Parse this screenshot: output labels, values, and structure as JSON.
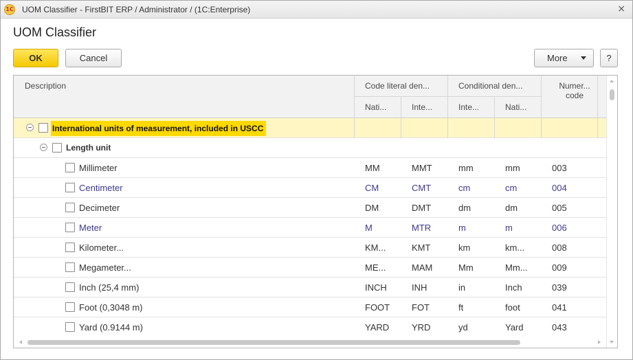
{
  "window": {
    "title": "UOM Classifier - FirstBIT ERP / Administrator /  (1C:Enterprise)",
    "logo_text": "1C",
    "close_glyph": "×"
  },
  "form": {
    "title": "UOM Classifier"
  },
  "toolbar": {
    "ok_label": "OK",
    "cancel_label": "Cancel",
    "more_label": "More",
    "help_label": "?"
  },
  "table": {
    "headers": {
      "description": "Description",
      "code_literal": "Code literal den...",
      "conditional": "Conditional den...",
      "numeric_code": "Numer...\ncode",
      "sub": [
        "Nati...",
        "Inte...",
        "Inte...",
        "Nati..."
      ]
    },
    "group": {
      "label": "International units of measurement, included in USCC"
    },
    "subgroup": {
      "label": "Length unit"
    },
    "rows": [
      {
        "description": "Millimeter",
        "national": "MM",
        "international": "MMT",
        "cond_international": "mm",
        "cond_national": "mm",
        "numeric": "003",
        "highlight": false
      },
      {
        "description": "Centimeter",
        "national": "CM",
        "international": "CMT",
        "cond_international": "cm",
        "cond_national": "cm",
        "numeric": "004",
        "highlight": true
      },
      {
        "description": "Decimeter",
        "national": "DM",
        "international": "DMT",
        "cond_international": "dm",
        "cond_national": "dm",
        "numeric": "005",
        "highlight": false
      },
      {
        "description": "Meter",
        "national": "M",
        "international": "MTR",
        "cond_international": "m",
        "cond_national": "m",
        "numeric": "006",
        "highlight": true
      },
      {
        "description": "Kilometer...",
        "national": "KM...",
        "international": "KMT",
        "cond_international": "km",
        "cond_national": "km...",
        "numeric": "008",
        "highlight": false
      },
      {
        "description": "Megameter...",
        "national": "ME...",
        "international": "MAM",
        "cond_international": "Mm",
        "cond_national": "Mm...",
        "numeric": "009",
        "highlight": false
      },
      {
        "description": "Inch (25,4 mm)",
        "national": "INCH",
        "international": "INH",
        "cond_international": "in",
        "cond_national": "Inch",
        "numeric": "039",
        "highlight": false
      },
      {
        "description": "Foot (0,3048 m)",
        "national": "FOOT",
        "international": "FOT",
        "cond_international": "ft",
        "cond_national": "foot",
        "numeric": "041",
        "highlight": false
      },
      {
        "description": "Yard (0.9144 m)",
        "national": "YARD",
        "international": "YRD",
        "cond_international": "yd",
        "cond_national": "Yard",
        "numeric": "043",
        "highlight": false
      }
    ]
  },
  "colors": {
    "accent": "#ffd900",
    "group_row": "#fff6c4",
    "link_text": "#3e3a8c",
    "ok_button": "#f5c900"
  }
}
